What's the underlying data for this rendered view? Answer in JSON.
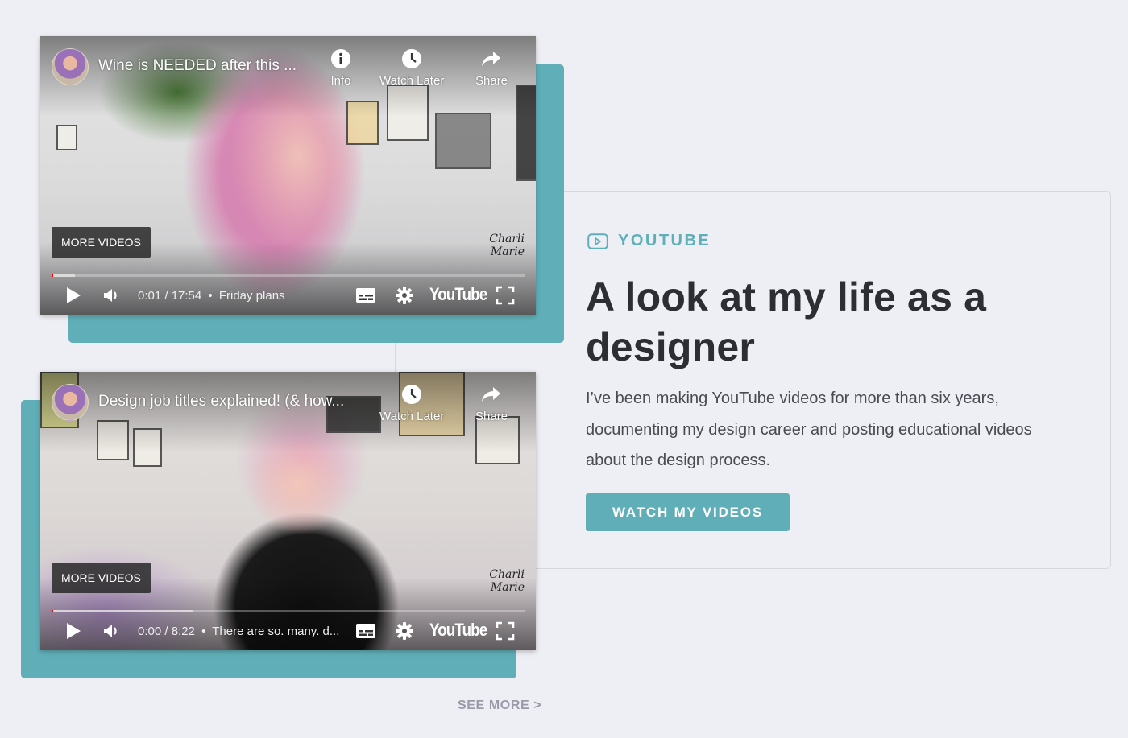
{
  "colors": {
    "accent": "#60afb8",
    "background": "#eeeff4",
    "heading": "#2d2e33",
    "body": "#4a4b52",
    "muted": "#9a9ba8"
  },
  "videos": [
    {
      "title": "Wine is NEEDED after this ...",
      "actions": [
        {
          "icon": "info-icon",
          "label": "Info"
        },
        {
          "icon": "clock-icon",
          "label": "Watch Later"
        },
        {
          "icon": "share-icon",
          "label": "Share"
        }
      ],
      "more_videos_label": "MORE VIDEOS",
      "time": "0:01 / 17:54",
      "chapter": "Friday plans",
      "progress_fraction": 0.001,
      "brand": "YouTube",
      "watermark": "Charli Marie"
    },
    {
      "title": "Design job titles explained! (& how...",
      "actions": [
        {
          "icon": "clock-icon",
          "label": "Watch Later"
        },
        {
          "icon": "share-icon",
          "label": "Share"
        }
      ],
      "more_videos_label": "MORE VIDEOS",
      "time": "0:00 / 8:22",
      "chapter": "There are so. many. d...",
      "progress_fraction": 0.0,
      "brand": "YouTube",
      "watermark": "Charli Marie"
    }
  ],
  "section": {
    "tag": "YOUTUBE",
    "tag_icon": "play-box-icon",
    "headline": "A look at my life as a designer",
    "body": "I’ve been making YouTube videos for more than six years, documenting my design career and posting educational videos about the design process.",
    "cta_label": "WATCH MY VIDEOS"
  },
  "see_more_label": "SEE MORE >"
}
